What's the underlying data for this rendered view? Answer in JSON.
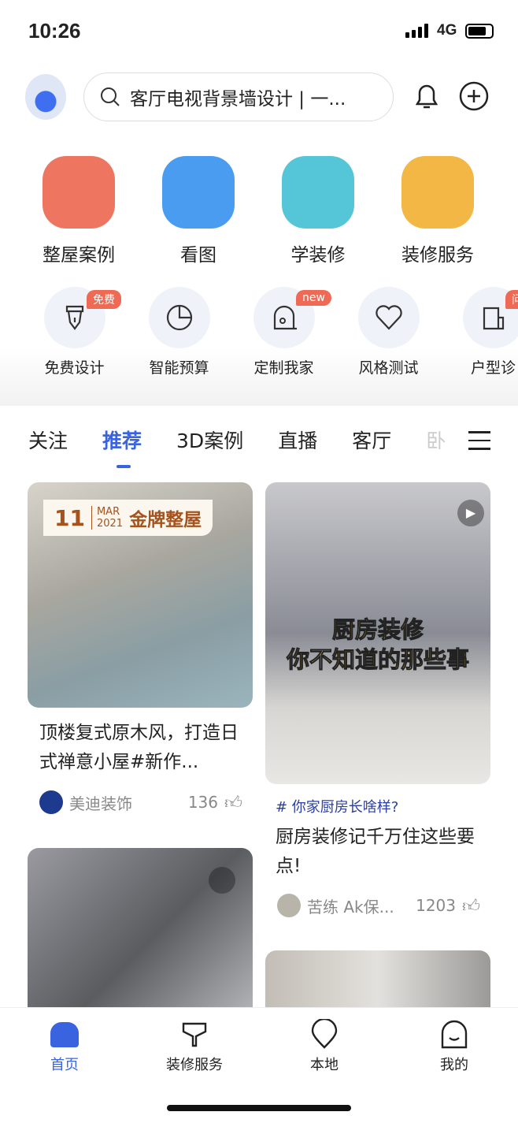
{
  "status": {
    "time": "10:26",
    "network": "4G"
  },
  "search": {
    "placeholder": "客厅电视背景墙设计 | 一..."
  },
  "main_entries": [
    {
      "label": "整屋案例",
      "color": "#ee7660"
    },
    {
      "label": "看图",
      "color": "#4a9cf0"
    },
    {
      "label": "学装修",
      "color": "#55c5d8"
    },
    {
      "label": "装修服务",
      "color": "#f2b744"
    }
  ],
  "tools": [
    {
      "label": "免费设计",
      "badge": "免费",
      "icon": "pen-nib-icon"
    },
    {
      "label": "智能预算",
      "badge": "",
      "icon": "pie-chart-icon"
    },
    {
      "label": "定制我家",
      "badge": "new",
      "icon": "tape-measure-icon"
    },
    {
      "label": "风格测试",
      "badge": "",
      "icon": "heart-icon"
    },
    {
      "label": "户型诊",
      "badge": "问",
      "icon": "floorplan-icon"
    }
  ],
  "tabs": [
    "关注",
    "推荐",
    "3D案例",
    "直播",
    "客厅",
    "卧"
  ],
  "active_tab": "推荐",
  "feed": [
    {
      "banner_day": "11",
      "banner_month": "MAR",
      "banner_year": "2021",
      "banner_title": "金牌整屋",
      "title": "顶楼复式原木风，打造日式禅意小屋#新作...",
      "author": "美迪装饰",
      "likes": "136"
    },
    {
      "overlay_line1": "厨房装修",
      "overlay_line2": "你不知道的那些事",
      "topic": "# 你家厨房长啥样?",
      "title": "厨房装修记千万住这些要点!",
      "author": "苦练 Ak保...",
      "likes": "1203"
    }
  ],
  "nav": [
    {
      "label": "首页",
      "active": true
    },
    {
      "label": "装修服务"
    },
    {
      "label": "本地"
    },
    {
      "label": "我的"
    }
  ],
  "accent": "#3a63e0"
}
